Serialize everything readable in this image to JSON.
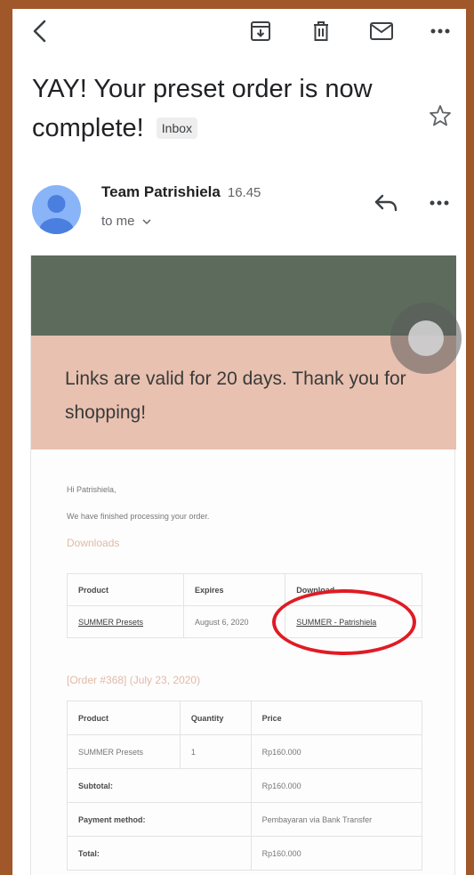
{
  "toolbar": {
    "icons": [
      "back-arrow-icon",
      "archive-icon",
      "delete-icon",
      "mail-icon",
      "more-icon"
    ]
  },
  "message": {
    "subject": "YAY! Your preset order is now complete!",
    "label": "Inbox",
    "sender": "Team Patrishiela",
    "time": "16.45",
    "recipient": "to me"
  },
  "email": {
    "hero_text": "Links are valid for 20 days. Thank you for shopping!",
    "greeting": "Hi Patrishiela,",
    "intro": "We have finished processing your order.",
    "downloads_heading": "Downloads",
    "downloads_table": {
      "headers": [
        "Product",
        "Expires",
        "Download"
      ],
      "row": {
        "product": "SUMMER Presets",
        "expires": "August 6, 2020",
        "download": "SUMMER - Patrishiela"
      }
    },
    "order_heading": "[Order #368] (July 23, 2020)",
    "order_table": {
      "headers": [
        "Product",
        "Quantity",
        "Price"
      ],
      "row": {
        "product": "SUMMER Presets",
        "quantity": "1",
        "price": "Rp160.000"
      },
      "subtotal_label": "Subtotal:",
      "subtotal_value": "Rp160.000",
      "payment_label": "Payment method:",
      "payment_value": "Pembayaran via Bank Transfer",
      "total_label": "Total:",
      "total_value": "Rp160.000"
    }
  },
  "colors": {
    "hero_dark": "#5d6b5d",
    "hero_pink": "#e8c1b0",
    "annotation": "#e01b24"
  }
}
